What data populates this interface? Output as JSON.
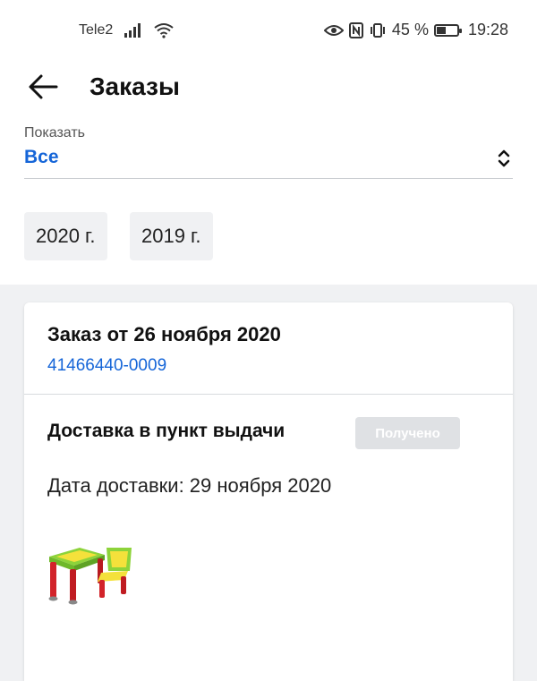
{
  "status_bar": {
    "carrier": "Tele2",
    "battery": "45 %",
    "battery_level": 0.45,
    "time": "19:28"
  },
  "header": {
    "title": "Заказы"
  },
  "filter": {
    "label": "Показать",
    "value": "Все"
  },
  "years": [
    "2020 г.",
    "2019 г."
  ],
  "order": {
    "title": "Заказ от 26 ноября 2020",
    "number": "41466440-0009",
    "delivery_type": "Доставка в пункт выдачи",
    "status": "Получено",
    "delivery_date": "Дата доставки: 29 ноября 2020"
  },
  "colors": {
    "accent": "#1565d8",
    "badge": "#dfe1e4"
  }
}
